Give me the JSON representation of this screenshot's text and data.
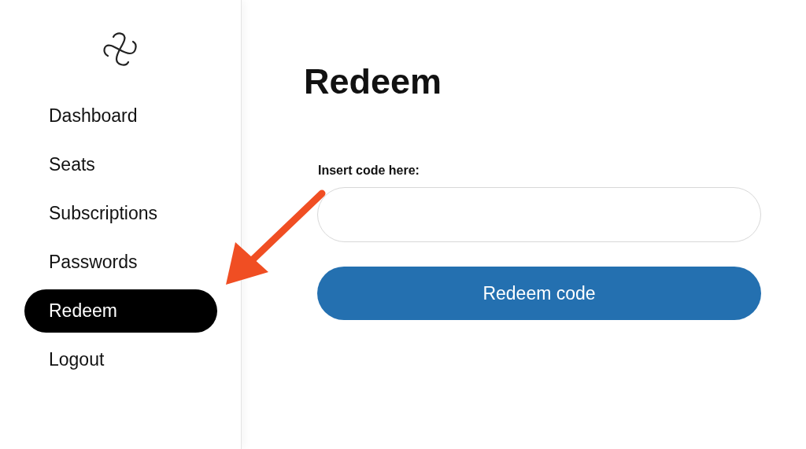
{
  "sidebar": {
    "items": [
      {
        "label": "Dashboard",
        "selected": false
      },
      {
        "label": "Seats",
        "selected": false
      },
      {
        "label": "Subscriptions",
        "selected": false
      },
      {
        "label": "Passwords",
        "selected": false
      },
      {
        "label": "Redeem",
        "selected": true
      },
      {
        "label": "Logout",
        "selected": false
      }
    ]
  },
  "page": {
    "title": "Redeem",
    "field": {
      "label": "Insert code here:"
    },
    "button": "Redeem code"
  }
}
